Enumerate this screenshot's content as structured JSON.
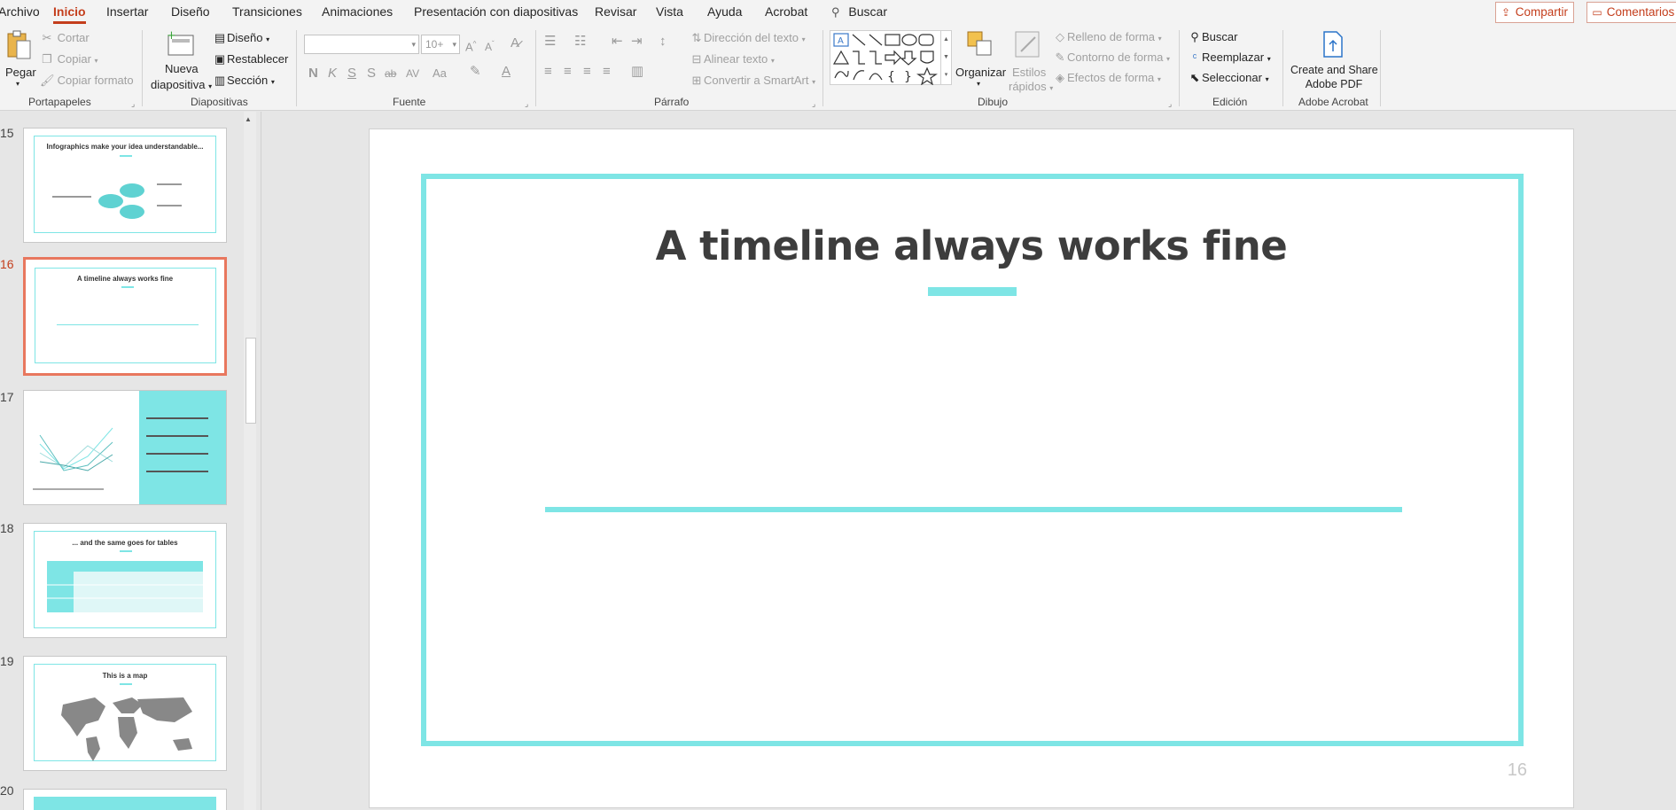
{
  "tabs": {
    "items": [
      "Archivo",
      "Inicio",
      "Insertar",
      "Diseño",
      "Transiciones",
      "Animaciones",
      "Presentación con diapositivas",
      "Revisar",
      "Vista",
      "Ayuda",
      "Acrobat"
    ],
    "search": "Buscar",
    "share": "Compartir",
    "comments": "Comentarios"
  },
  "ribbon": {
    "clipboard": {
      "label": "Portapapeles",
      "paste": "Pegar",
      "cut": "Cortar",
      "copy": "Copiar",
      "format_painter": "Copiar formato"
    },
    "slides": {
      "label": "Diapositivas",
      "new_slide_1": "Nueva",
      "new_slide_2": "diapositiva",
      "layout": "Diseño",
      "reset": "Restablecer",
      "section": "Sección"
    },
    "font": {
      "label": "Fuente",
      "font_name": "",
      "font_size": "10+"
    },
    "paragraph": {
      "label": "Párrafo",
      "text_direction": "Dirección del texto",
      "align_text": "Alinear texto",
      "smartart": "Convertir a SmartArt"
    },
    "drawing": {
      "label": "Dibujo",
      "arrange": "Organizar",
      "quick_styles_1": "Estilos",
      "quick_styles_2": "rápidos",
      "shape_fill": "Relleno de forma",
      "shape_outline": "Contorno de forma",
      "shape_effects": "Efectos de forma"
    },
    "editing": {
      "label": "Edición",
      "find": "Buscar",
      "replace": "Reemplazar",
      "select": "Seleccionar"
    },
    "acrobat": {
      "label": "Adobe Acrobat",
      "create_share_1": "Create and Share",
      "create_share_2": "Adobe PDF"
    }
  },
  "thumbnails": [
    {
      "num": "15",
      "title": "Infographics make your idea understandable..."
    },
    {
      "num": "16",
      "title": "A timeline always works fine"
    },
    {
      "num": "17",
      "title": ""
    },
    {
      "num": "18",
      "title": "... and the same goes for tables"
    },
    {
      "num": "19",
      "title": "This is a map"
    },
    {
      "num": "20",
      "title": ""
    }
  ],
  "slide": {
    "title": "A timeline always works fine",
    "page_number": "16"
  },
  "colors": {
    "accent": "#7ee5e5",
    "office_red": "#c43e1c",
    "selected_thumb": "#e8775e"
  }
}
